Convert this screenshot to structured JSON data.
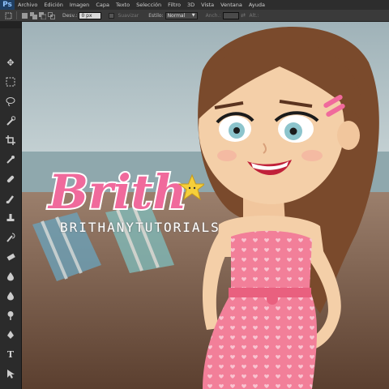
{
  "app": {
    "logo": "Ps"
  },
  "menu": [
    "Archivo",
    "Edición",
    "Imagen",
    "Capa",
    "Texto",
    "Selección",
    "Filtro",
    "3D",
    "Vista",
    "Ventana",
    "Ayuda"
  ],
  "options": {
    "feather_label": "Desv.:",
    "feather_value": "0 px",
    "antialias_label": "Suavizar",
    "style_label": "Estilo:",
    "style_value": "Normal",
    "width_label": "Anch.:",
    "height_label": "Alt.:"
  },
  "tools": [
    "move-icon",
    "marquee-icon",
    "lasso-icon",
    "quick-select-icon",
    "crop-icon",
    "eyedropper-icon",
    "healing-brush-icon",
    "brush-icon",
    "clone-stamp-icon",
    "history-brush-icon",
    "eraser-icon",
    "gradient-icon",
    "blur-icon",
    "dodge-icon",
    "pen-icon",
    "type-icon",
    "path-select-icon",
    "shape-icon",
    "hand-icon",
    "zoom-icon"
  ],
  "artwork": {
    "logo_text": "Brith",
    "credit_text": "BRITHANYTUTORIALS",
    "colors": {
      "pink": "#f06a9c",
      "dress": "#f27f99",
      "hair": "#7a4a2c",
      "skin": "#f4cfa8",
      "sea": "#a7c0c8"
    }
  }
}
